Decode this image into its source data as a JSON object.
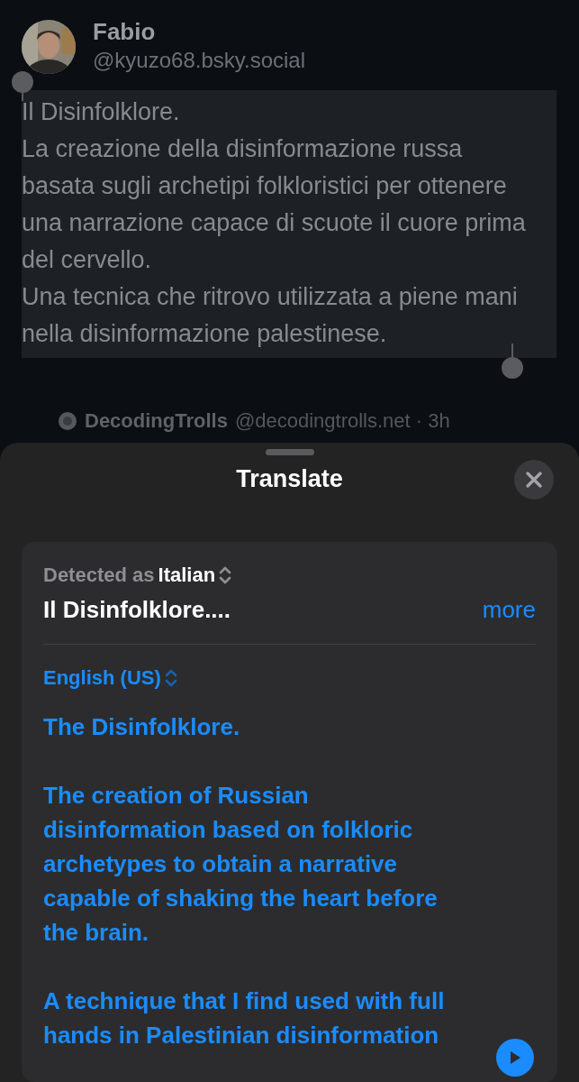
{
  "post": {
    "author": "Fabio",
    "handle": "@kyuzo68.bsky.social",
    "lines": [
      "Il Disinfolklore.",
      "La creazione della disinformazione russa basata sugli archetipi folkloristici per ottenere una narrazione capace di scuote il cuore prima del cervello.",
      "Una tecnica che ritrovo utilizzata a piene mani nella disinformazione palestinese."
    ],
    "selected": true
  },
  "next_post": {
    "author": "DecodingTrolls",
    "meta": "@decodingtrolls.net · 3h"
  },
  "sheet": {
    "title": "Translate",
    "source": {
      "label": "Detected as",
      "language": "Italian",
      "text": "Il Disinfolklore....",
      "more": "more"
    },
    "target": {
      "language": "English (US)",
      "paragraphs": [
        "The Disinfolklore.",
        "The creation of Russian disinformation based on folkloric archetypes to obtain a narrative capable of shaking the heart before the brain.",
        "A technique that I find used with full hands in Palestinian disinformation"
      ]
    }
  }
}
